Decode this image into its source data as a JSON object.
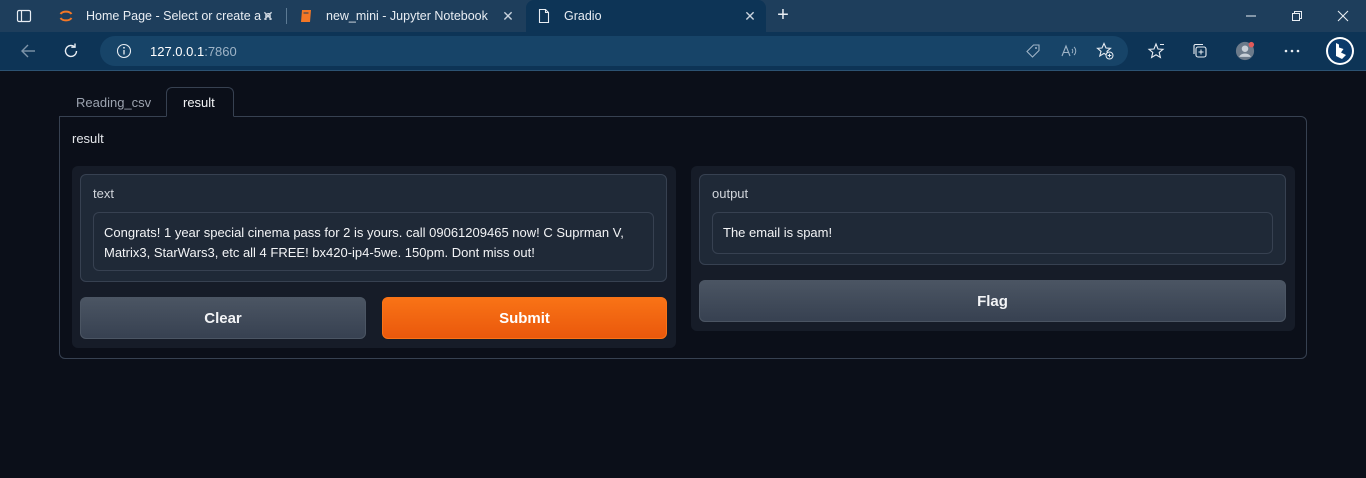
{
  "browser": {
    "tabs": [
      {
        "title": "Home Page - Select or create a n",
        "icon": "jupyter-logo-icon"
      },
      {
        "title": "new_mini - Jupyter Notebook",
        "icon": "notebook-icon"
      },
      {
        "title": "Gradio",
        "icon": "page-icon",
        "active": true
      }
    ],
    "url_host": "127.0.0.1",
    "url_port": ":7860",
    "accent": "#0d3456"
  },
  "app": {
    "tabs": [
      {
        "label": "Reading_csv"
      },
      {
        "label": "result",
        "active": true
      }
    ],
    "panel_label": "result",
    "input": {
      "label": "text",
      "value": "Congrats! 1 year special cinema pass for 2 is yours. call 09061209465 now! C Suprman V, Matrix3, StarWars3, etc all 4 FREE! bx420-ip4-5we. 150pm. Dont miss out!"
    },
    "output": {
      "label": "output",
      "value": "The email is spam!"
    },
    "buttons": {
      "clear": "Clear",
      "submit": "Submit",
      "flag": "Flag"
    },
    "colors": {
      "primary": "#f97316",
      "background": "#0b0f19"
    }
  }
}
